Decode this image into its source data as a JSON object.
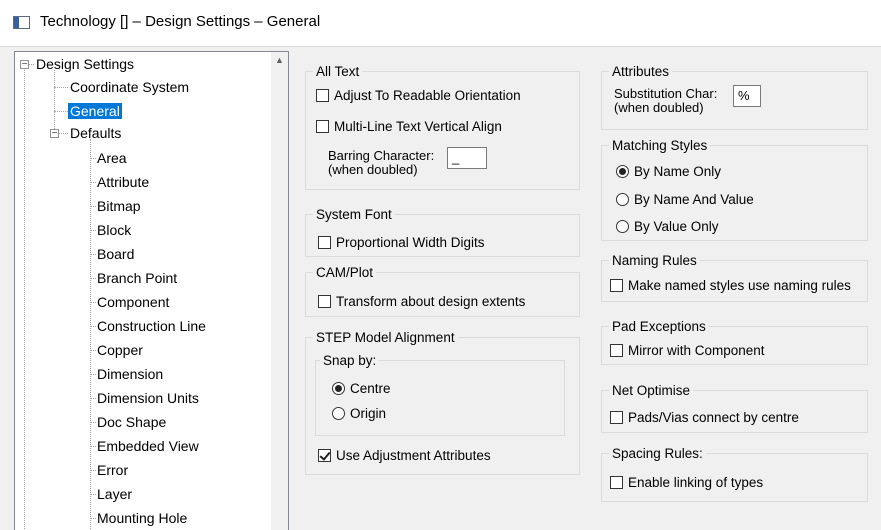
{
  "window": {
    "title": "Technology [] – Design Settings – General"
  },
  "tree": {
    "root": "Design Settings",
    "children": [
      "Coordinate System",
      "General",
      "Defaults"
    ],
    "selected": "General",
    "defaults_children": [
      "Area",
      "Attribute",
      "Bitmap",
      "Block",
      "Board",
      "Branch Point",
      "Component",
      "Construction Line",
      "Copper",
      "Dimension",
      "Dimension Units",
      "Doc Shape",
      "Embedded View",
      "Error",
      "Layer",
      "Mounting Hole"
    ]
  },
  "all_text": {
    "title": "All Text",
    "adjust_readable": {
      "label": "Adjust To Readable Orientation",
      "checked": false
    },
    "multiline_align": {
      "label": "Multi-Line Text Vertical Align",
      "checked": false
    },
    "barring_label": "Barring Character:",
    "barring_sub": "(when doubled)",
    "barring_value": "_"
  },
  "system_font": {
    "title": "System Font",
    "proportional": {
      "label": "Proportional Width Digits",
      "checked": false
    }
  },
  "cam_plot": {
    "title": "CAM/Plot",
    "transform": {
      "label": "Transform about design extents",
      "checked": false
    }
  },
  "step": {
    "title": "STEP Model Alignment",
    "snap_title": "Snap by:",
    "centre": "Centre",
    "origin": "Origin",
    "selected": "Centre",
    "use_adjust": {
      "label": "Use Adjustment Attributes",
      "checked": true
    }
  },
  "attributes": {
    "title": "Attributes",
    "sub_label": "Substitution Char:",
    "sub_sub": "(when doubled)",
    "sub_value": "%"
  },
  "matching": {
    "title": "Matching Styles",
    "options": [
      "By Name Only",
      "By Name And Value",
      "By Value Only"
    ],
    "selected": "By Name Only"
  },
  "naming": {
    "title": "Naming Rules",
    "named_styles": {
      "label": "Make named styles use naming rules",
      "checked": false
    }
  },
  "pad_exceptions": {
    "title": "Pad Exceptions",
    "mirror": {
      "label": "Mirror with Component",
      "checked": false
    }
  },
  "net_optimise": {
    "title": "Net Optimise",
    "pads_vias": {
      "label": "Pads/Vias connect by centre",
      "checked": false
    }
  },
  "spacing": {
    "title": "Spacing Rules:",
    "enable_linking": {
      "label": "Enable linking of types",
      "checked": false
    }
  }
}
